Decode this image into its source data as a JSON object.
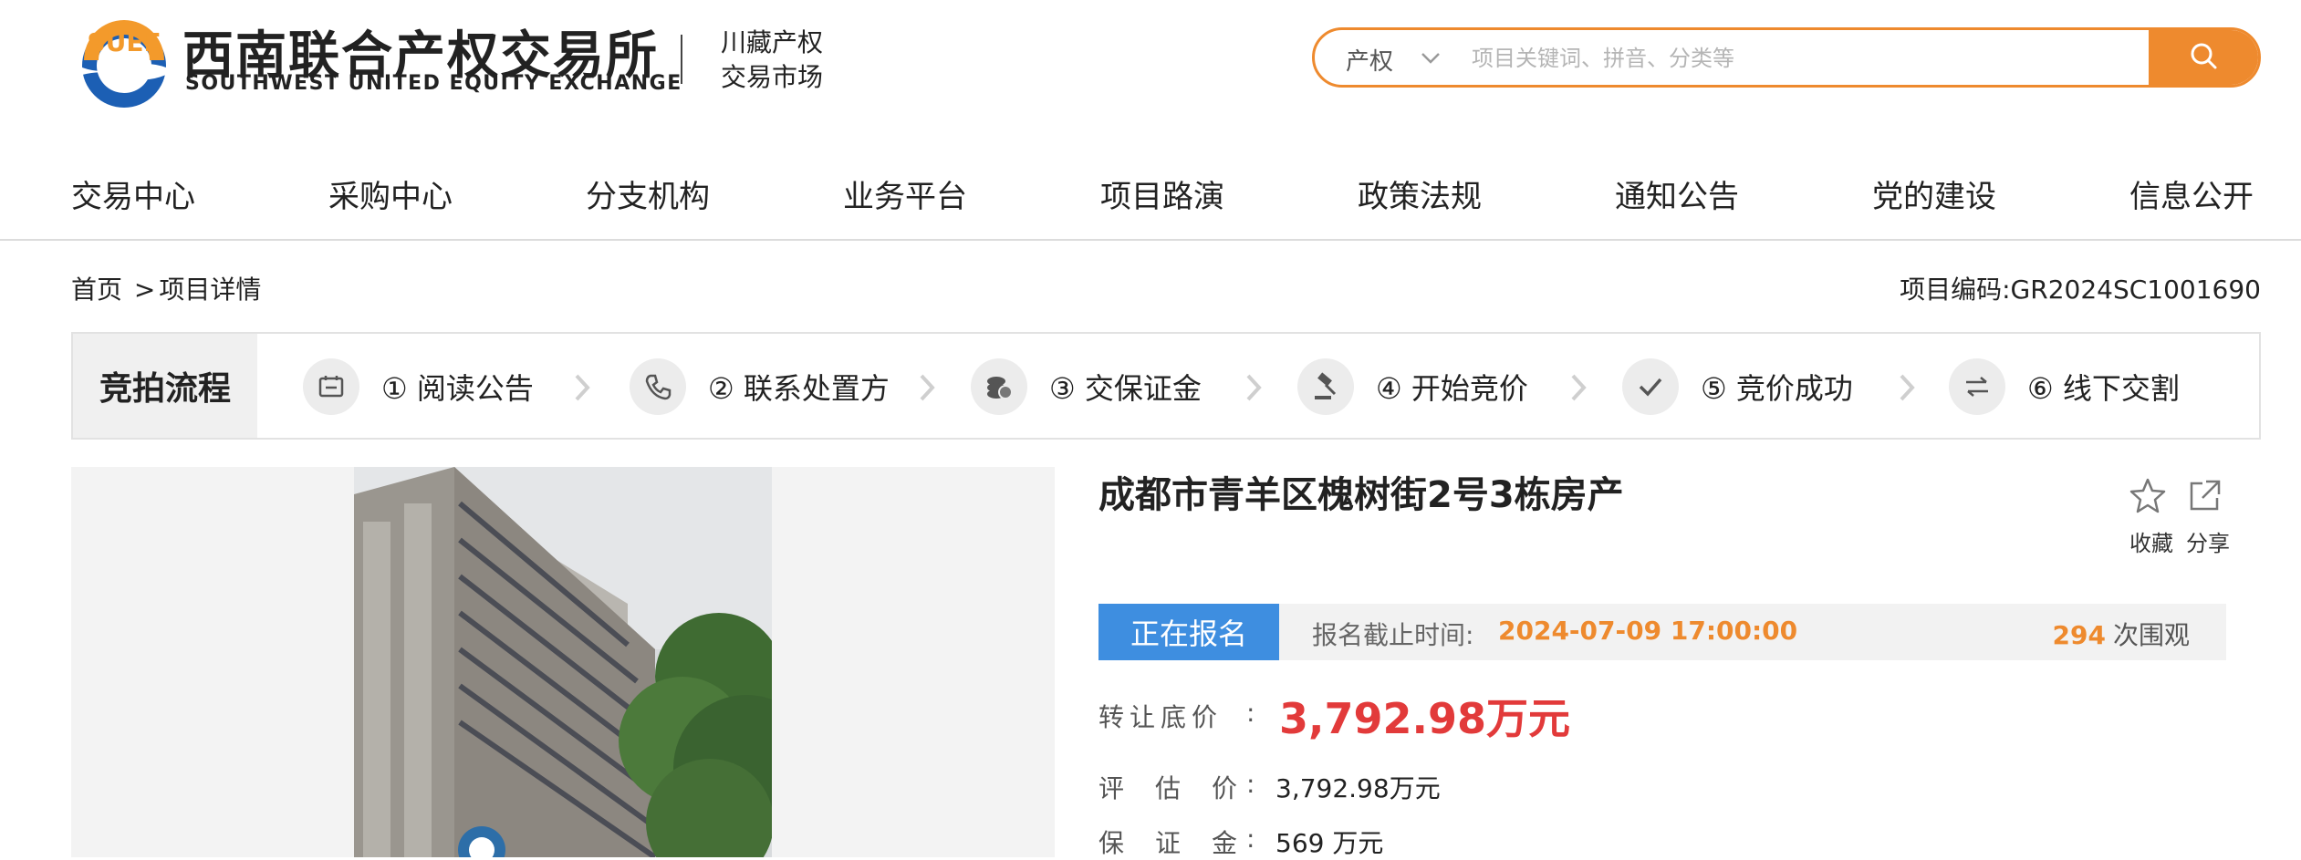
{
  "header": {
    "logo_cn": "西南联合产权交易所",
    "logo_en": "SOUTHWEST UNITED EQUITY EXCHANGE",
    "logo_sub_line1": "川藏产权",
    "logo_sub_line2": "交易市场",
    "search": {
      "category": "产权",
      "placeholder": "项目关键词、拼音、分类等"
    },
    "brand_color": "#ee8a2e"
  },
  "nav": {
    "items": [
      "交易中心",
      "采购中心",
      "分支机构",
      "业务平台",
      "项目路演",
      "政策法规",
      "通知公告",
      "党的建设",
      "信息公开"
    ]
  },
  "breadcrumb": {
    "home": "首页",
    "separator": ">",
    "current": "项目详情"
  },
  "project_code": "项目编码:GR2024SC1001690",
  "process": {
    "label": "竞拍流程",
    "steps": [
      {
        "label": "① 阅读公告",
        "icon": "announcement-icon"
      },
      {
        "label": "② 联系处置方",
        "icon": "phone-icon"
      },
      {
        "label": "③ 交保证金",
        "icon": "coins-icon"
      },
      {
        "label": "④ 开始竞价",
        "icon": "gavel-icon"
      },
      {
        "label": "⑤ 竞价成功",
        "icon": "check-icon"
      },
      {
        "label": "⑥ 线下交割",
        "icon": "exchange-icon"
      }
    ]
  },
  "detail": {
    "title": "成都市青羊区槐树街2号3栋房产",
    "favorite_label": "收藏",
    "share_label": "分享",
    "status": "正在报名",
    "deadline_label": "报名截止时间:",
    "deadline_value": "2024-07-09 17:00:00",
    "views_count": "294",
    "views_suffix": "次围观",
    "base_price_label": "转让底价",
    "base_price_value": "3,792.98万元",
    "appraisal_label": "评估价",
    "appraisal_value": "3,792.98万元",
    "deposit_label": "保证金",
    "deposit_value": "569 万元",
    "colon": ":",
    "status_color": "#3e8ee0",
    "price_color": "#e23a3a"
  }
}
